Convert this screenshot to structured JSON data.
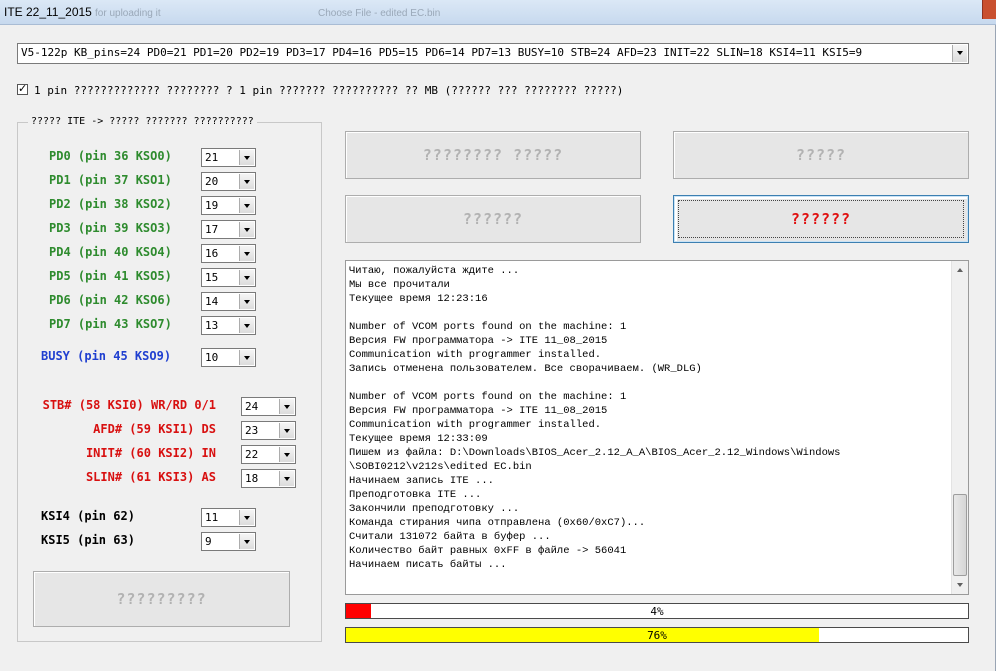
{
  "window": {
    "title": "ITE 22_11_2015",
    "ghost_text_1": "for uploading it",
    "ghost_text_2": "Choose File - edited EC.bin"
  },
  "config_select": {
    "value": "V5-122p KB_pins=24 PD0=21 PD1=20 PD2=19 PD3=17 PD4=16 PD5=15 PD6=14 PD7=13 BUSY=10 STB=24 AFD=23 INIT=22 SLIN=18 KSI4=11 KSI5=9"
  },
  "one_pin_checkbox": {
    "checked": true,
    "label": "1 pin ????????????? ???????? ? 1 pin ??????? ?????????? ?? MB (?????? ??? ???????? ?????)"
  },
  "pins_group": {
    "legend": "????? ITE -> ????? ??????? ??????????",
    "data_pins": [
      {
        "label": "PD0 (pin 36 KSO0)",
        "value": "21"
      },
      {
        "label": "PD1 (pin 37 KSO1)",
        "value": "20"
      },
      {
        "label": "PD2 (pin 38 KSO2)",
        "value": "19"
      },
      {
        "label": "PD3 (pin 39 KSO3)",
        "value": "17"
      },
      {
        "label": "PD4 (pin 40 KSO4)",
        "value": "16"
      },
      {
        "label": "PD5 (pin 41 KSO5)",
        "value": "15"
      },
      {
        "label": "PD6 (pin 42 KSO6)",
        "value": "14"
      },
      {
        "label": "PD7 (pin 43 KSO7)",
        "value": "13"
      }
    ],
    "busy": {
      "label": "BUSY (pin 45 KSO9)",
      "value": "10"
    },
    "control_pins": [
      {
        "label": "STB# (58 KSI0) WR/RD 0/1",
        "value": "24"
      },
      {
        "label": "AFD# (59 KSI1) DS",
        "value": "23"
      },
      {
        "label": "INIT# (60 KSI2) IN",
        "value": "22"
      },
      {
        "label": "SLIN# (61 KSI3) AS",
        "value": "18"
      }
    ],
    "ksi_pins": [
      {
        "label": "KSI4 (pin 62)",
        "value": "11"
      },
      {
        "label": "KSI5 (pin 63)",
        "value": "9"
      }
    ],
    "bottom_button": "?????????"
  },
  "buttons": {
    "top_left": "???????? ?????",
    "top_right": "?????",
    "middle_left": "??????",
    "middle_right": "??????"
  },
  "log": {
    "lines": [
      "Читаю, пожалуйста ждите ...",
      "Мы все прочитали",
      "Текущее время  12:23:16",
      "",
      "Number of VCOM ports found on the machine: 1",
      "Версия FW программатора -> ITE 11_08_2015",
      "Communication with programmer installed.",
      "Запись отменена пользователем. Все сворачиваем. (WR_DLG)",
      "",
      "Number of VCOM ports found on the machine: 1",
      "Версия FW программатора -> ITE 11_08_2015",
      "Communication with programmer installed.",
      "Текущее время  12:33:09",
      "Пишем из файла: D:\\Downloads\\BIOS_Acer_2.12_A_A\\BIOS_Acer_2.12_Windows\\Windows",
      "\\SOBI0212\\v212s\\edited EC.bin",
      "Начинаем запись ITE ...",
      "Преподготовка ITE ...",
      "Закончили преподготовку ...",
      "Команда стирания чипа отправлена (0x60/0xC7)...",
      "Считали 131072 байта в буфер ...",
      "Количество байт равных 0xFF в файле -> 56041",
      "Начинаем писать байты ..."
    ]
  },
  "progress": {
    "bar1": {
      "percent": 4,
      "text": "4%",
      "color": "#ff0000"
    },
    "bar2": {
      "percent": 76,
      "text": "76%",
      "color": "#ffff00"
    }
  },
  "colors": {
    "data_pin_label": "#2e8b2e",
    "busy_label": "#1f3fd0",
    "control_label": "#d81010",
    "active_button_text": "#e01010",
    "disabled_button_text": "#b2b2b2"
  }
}
